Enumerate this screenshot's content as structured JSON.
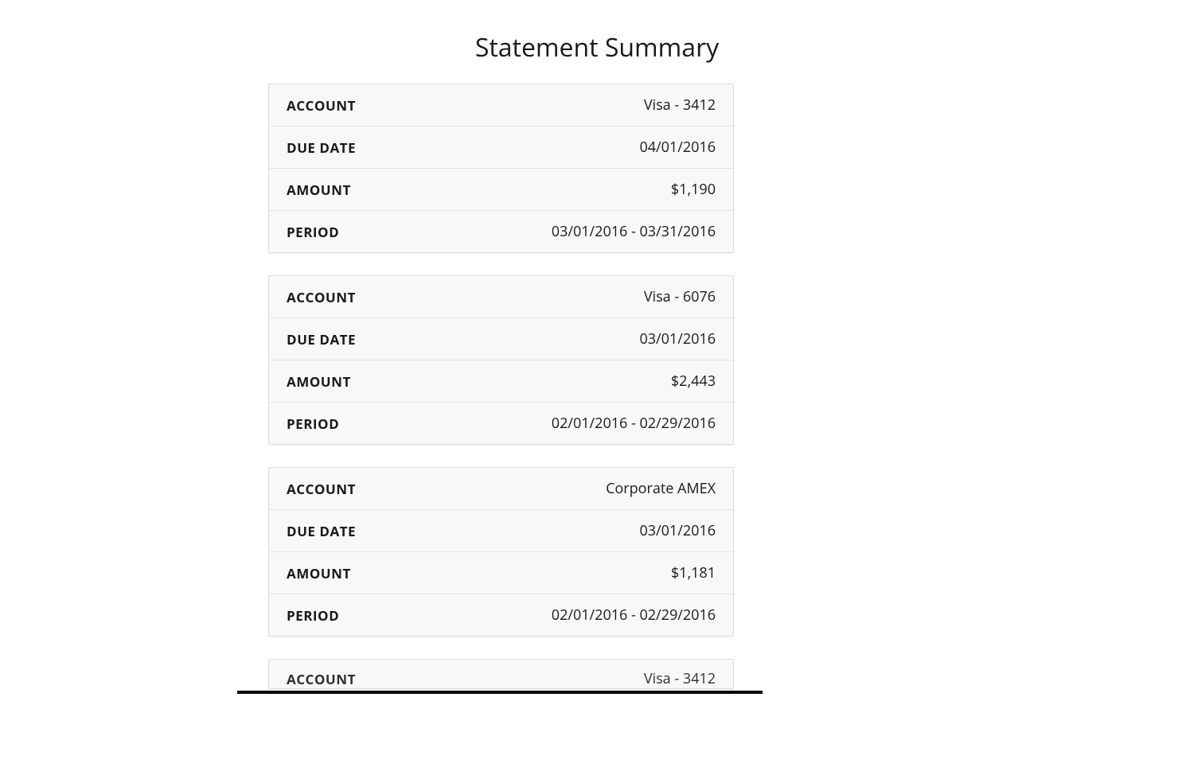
{
  "title": "Statement Summary",
  "labels": {
    "account": "ACCOUNT",
    "due_date": "DUE DATE",
    "amount": "AMOUNT",
    "period": "PERIOD"
  },
  "statements": [
    {
      "account": "Visa - 3412",
      "due_date": "04/01/2016",
      "amount": "$1,190",
      "period": "03/01/2016 - 03/31/2016"
    },
    {
      "account": "Visa - 6076",
      "due_date": "03/01/2016",
      "amount": "$2,443",
      "period": "02/01/2016 - 02/29/2016"
    },
    {
      "account": "Corporate AMEX",
      "due_date": "03/01/2016",
      "amount": "$1,181",
      "period": "02/01/2016 - 02/29/2016"
    },
    {
      "account": "Visa - 3412",
      "due_date": "",
      "amount": "",
      "period": ""
    }
  ]
}
